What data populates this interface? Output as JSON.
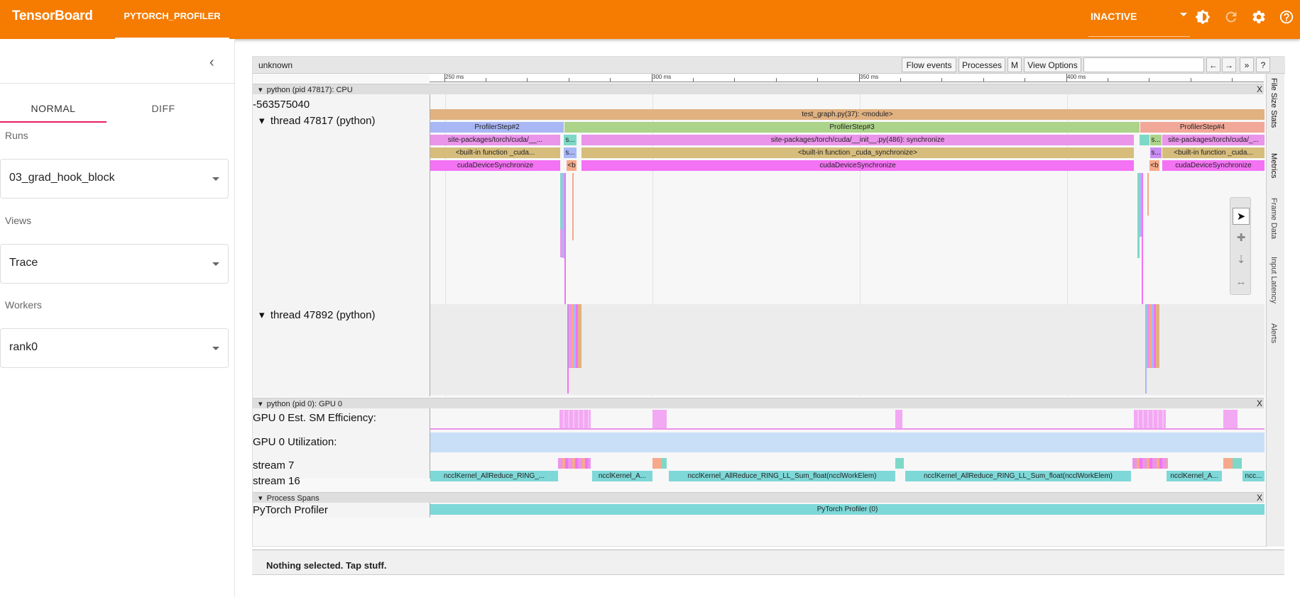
{
  "app": {
    "brand": "TensorBoard",
    "plugin_tab": "PYTORCH_PROFILER",
    "status": "INACTIVE",
    "icons": [
      "brightness-icon",
      "refresh-icon",
      "gear-icon",
      "help-icon"
    ]
  },
  "sidebar": {
    "modes": [
      "NORMAL",
      "DIFF"
    ],
    "active_mode": "NORMAL",
    "runs_label": "Runs",
    "runs_value": "03_grad_hook_block",
    "views_label": "Views",
    "views_value": "Trace",
    "workers_label": "Workers",
    "workers_value": "rank0"
  },
  "trace": {
    "title": "unknown",
    "toolbar": {
      "flow_events": "Flow events",
      "processes": "Processes",
      "m": "M",
      "view_options": "View Options",
      "nav_left": "←",
      "nav_right": "→",
      "more": "»",
      "help": "?"
    },
    "ruler": [
      "250 ms",
      "300 ms",
      "350 ms",
      "400 ms"
    ],
    "cpu_process": "python (pid 47817): CPU",
    "cpu_counter": "-563575040",
    "thread1": "thread 47817 (python)",
    "thread2": "thread 47892 (python)",
    "gpu_process": "python (pid 0): GPU 0",
    "gpu_sm": "GPU 0 Est. SM Efficiency:",
    "gpu_util": "GPU 0 Utilization:",
    "stream7": "stream 7",
    "stream16": "stream 16",
    "spans_process": "Process Spans",
    "profiler_track": "PyTorch Profiler",
    "close": "X",
    "side_tabs": [
      "File Size Stats",
      "Metrics",
      "Frame Data",
      "Input Latency",
      "Alerts"
    ],
    "slices": {
      "module": "test_graph.py(37): <module>",
      "step2": "ProfilerStep#2",
      "step3": "ProfilerStep#3",
      "step4": "ProfilerStep#4",
      "site_a": "site-packages/torch/cuda/__...",
      "site_b": "site-packages/torch/cuda/__init__.py(486): synchronize",
      "site_c": "site-packages/torch/cuda/_...",
      "s": "s...",
      "builtin_a": "<built-in function _cuda...",
      "builtin_b": "<built-in function _cuda_synchronize>",
      "builtin_c": "<built-in function _cuda...",
      "cudasync": "cudaDeviceSynchronize",
      "b": "<b",
      "nccl_a": "ncclKernel_AllReduce_RING_...",
      "nccl_b": "ncclKernel_A...",
      "nccl_c": "ncclKernel_AllReduce_RING_LL_Sum_float(ncclWorkElem)",
      "nccl_d": "ncclKernel_AllReduce_RING_LL_Sum_float(ncclWorkElem)",
      "nccl_e": "ncclKernel_A...",
      "nccl_f": "ncc...",
      "pytorch_profiler": "PyTorch Profiler (0)"
    }
  },
  "selection": "Nothing selected. Tap stuff."
}
